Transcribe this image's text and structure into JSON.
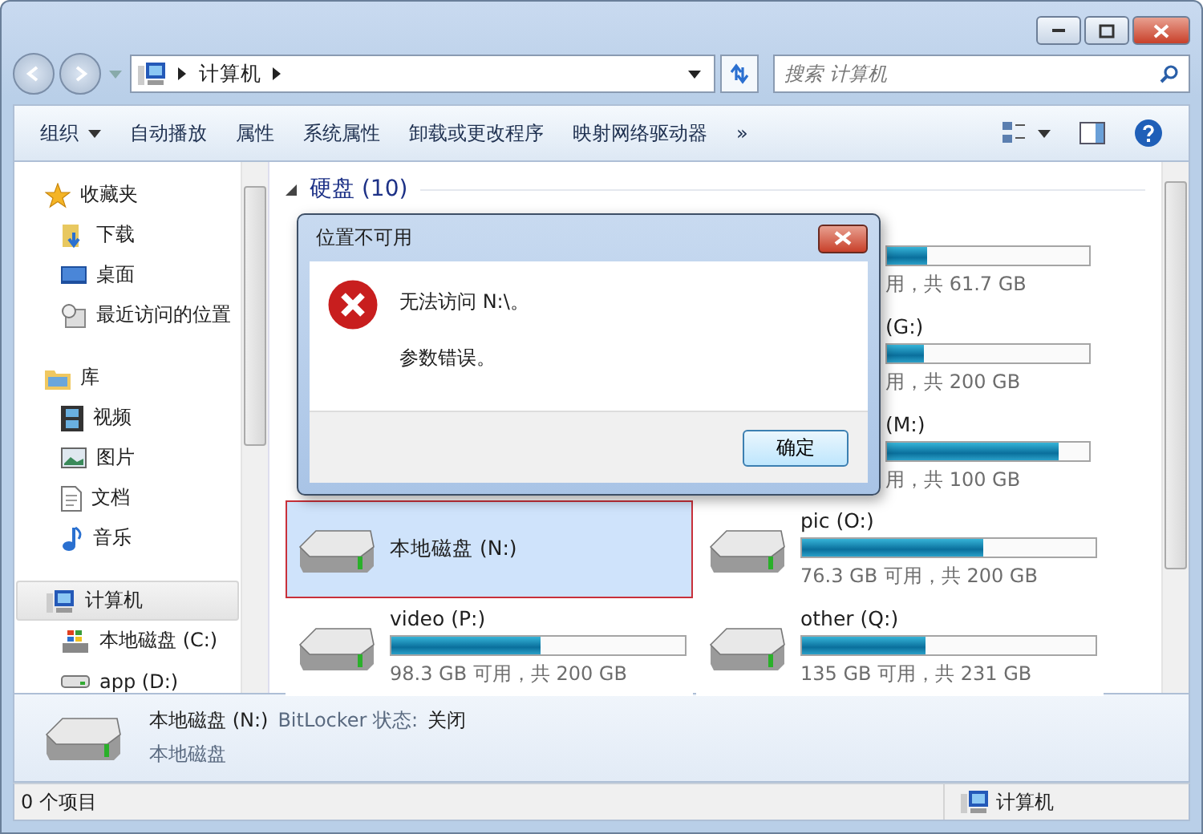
{
  "address": {
    "path": [
      "计算机"
    ],
    "search_placeholder": "搜索 计算机"
  },
  "toolbar": {
    "items": [
      {
        "label": "组织",
        "dropdown": true
      },
      {
        "label": "自动播放",
        "dropdown": false
      },
      {
        "label": "属性",
        "dropdown": false
      },
      {
        "label": "系统属性",
        "dropdown": false
      },
      {
        "label": "卸载或更改程序",
        "dropdown": false
      },
      {
        "label": "映射网络驱动器",
        "dropdown": false
      }
    ],
    "more": "»"
  },
  "sidebar": {
    "groups": [
      {
        "label": "收藏夹",
        "selected": false,
        "children": [
          {
            "label": "下载",
            "selected": false
          },
          {
            "label": "桌面",
            "selected": false
          },
          {
            "label": "最近访问的位置",
            "selected": false
          }
        ]
      },
      {
        "label": "库",
        "selected": false,
        "children": [
          {
            "label": "视频",
            "selected": false
          },
          {
            "label": "图片",
            "selected": false
          },
          {
            "label": "文档",
            "selected": false
          },
          {
            "label": "音乐",
            "selected": false
          }
        ]
      },
      {
        "label": "计算机",
        "selected": true,
        "children": [
          {
            "label": "本地磁盘 (C:)",
            "selected": false
          },
          {
            "label": "app (D:)",
            "selected": false
          }
        ]
      }
    ]
  },
  "content": {
    "group_title": "硬盘 (10)",
    "expanded": true,
    "drives": [
      {
        "kind": "partial",
        "level": 0.2,
        "reading": "用，共 61.7 GB"
      },
      {
        "kind": "partial",
        "name": "(G:)",
        "level": 0.18,
        "reading": "用，共 200 GB"
      },
      {
        "kind": "partial",
        "name": "(M:)",
        "level": 0.85,
        "reading": "用，共 100 GB"
      },
      {
        "kind": "full",
        "name": "本地磁盘 (N:)",
        "selected": true
      },
      {
        "kind": "full",
        "name": "pic (O:)",
        "level": 0.62,
        "reading": "76.3 GB 可用，共 200 GB",
        "selected": false
      },
      {
        "kind": "full",
        "name": "video (P:)",
        "level": 0.51,
        "reading": "98.3 GB 可用，共 200 GB",
        "selected": false
      },
      {
        "kind": "full",
        "name": "other (Q:)",
        "level": 0.42,
        "reading": "135 GB 可用，共 231 GB",
        "selected": false
      }
    ]
  },
  "dialog": {
    "title": "位置不可用",
    "message": "无法访问 N:\\。",
    "detail": "参数错误。",
    "button": "确定"
  },
  "details": {
    "name": "本地磁盘 (N:)",
    "field_label": "BitLocker 状态:",
    "field_value": "关闭",
    "type": "本地磁盘"
  },
  "status_bar": {
    "count": "0 个项目",
    "location": "计算机"
  }
}
